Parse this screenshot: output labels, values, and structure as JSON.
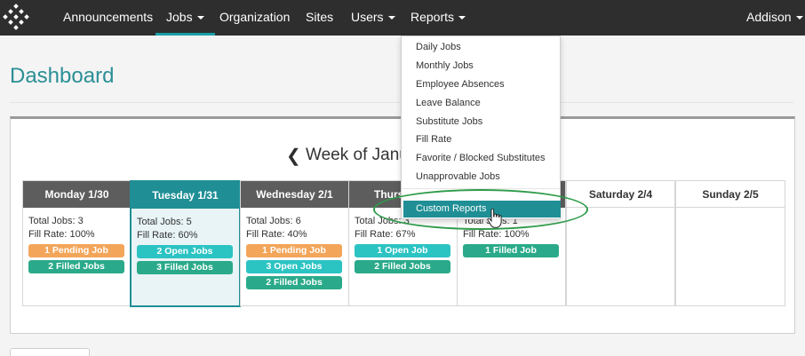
{
  "nav": {
    "items": [
      {
        "label": "Announcements",
        "dropdown": false
      },
      {
        "label": "Jobs",
        "dropdown": true,
        "active": true
      },
      {
        "label": "Organization",
        "dropdown": false
      },
      {
        "label": "Sites",
        "dropdown": false
      },
      {
        "label": "Users",
        "dropdown": true
      },
      {
        "label": "Reports",
        "dropdown": true
      }
    ],
    "user": "Addison"
  },
  "page": {
    "title": "Dashboard",
    "week_label": "Week of Janu"
  },
  "days": [
    {
      "name": "Monday 1/30",
      "total": "Total Jobs: 3",
      "fill": "Fill Rate: 100%",
      "pills": [
        {
          "label": "1 Pending Job",
          "color": "orange"
        },
        {
          "label": "2 Filled Jobs",
          "color": "green"
        }
      ]
    },
    {
      "name": "Tuesday 1/31",
      "total": "Total Jobs: 5",
      "fill": "Fill Rate: 60%",
      "pills": [
        {
          "label": "2 Open Jobs",
          "color": "teal"
        },
        {
          "label": "3 Filled Jobs",
          "color": "green"
        }
      ],
      "selected": true
    },
    {
      "name": "Wednesday 2/1",
      "total": "Total Jobs: 6",
      "fill": "Fill Rate: 40%",
      "pills": [
        {
          "label": "1 Pending Job",
          "color": "orange"
        },
        {
          "label": "3 Open Jobs",
          "color": "teal"
        },
        {
          "label": "2 Filled Jobs",
          "color": "green"
        }
      ]
    },
    {
      "name": "Thurs",
      "total": "Total Jobs: 3",
      "fill": "Fill Rate: 67%",
      "pills": [
        {
          "label": "1 Open Job",
          "color": "teal"
        },
        {
          "label": "2 Filled Jobs",
          "color": "green"
        }
      ]
    },
    {
      "name": "",
      "total": "Total Jobs: 1",
      "fill": "Fill Rate: 100%",
      "pills": [
        {
          "label": "1 Filled Job",
          "color": "green"
        }
      ]
    },
    {
      "name": "Saturday 2/4",
      "total": "",
      "fill": "",
      "pills": []
    },
    {
      "name": "Sunday 2/5",
      "total": "",
      "fill": "",
      "pills": []
    }
  ],
  "reports_menu": {
    "items": [
      "Daily Jobs",
      "Monthly Jobs",
      "Employee Absences",
      "Leave Balance",
      "Substitute Jobs",
      "Fill Rate",
      "Favorite / Blocked Substitutes",
      "Unapprovable Jobs"
    ],
    "highlighted": "Custom Reports"
  },
  "colors": {
    "nav_bg": "#2e2e2e",
    "accent": "#1f8f95",
    "pending": "#f3a55a",
    "filled": "#2aaa8a",
    "open": "#2cc3c3",
    "highlight_ring": "#2e9b4a"
  }
}
